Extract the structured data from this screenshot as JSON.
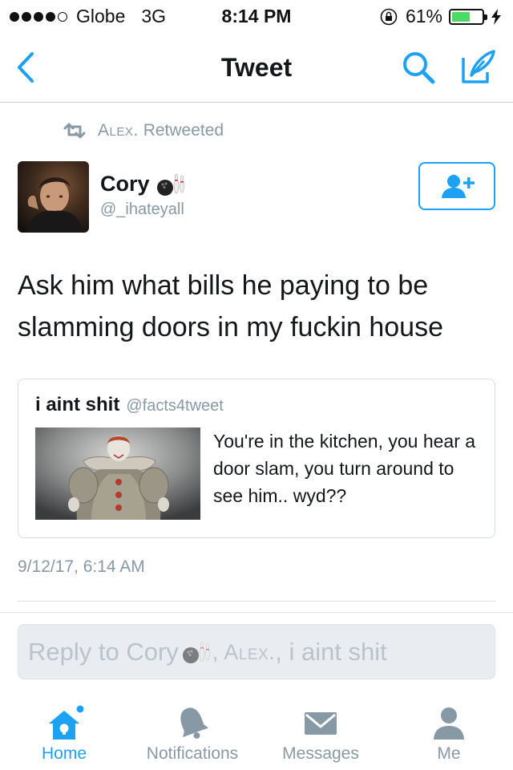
{
  "status_bar": {
    "carrier": "Globe",
    "network": "3G",
    "time": "8:14 PM",
    "battery": "61%",
    "battery_level": 0.61,
    "signal_dots_filled": 4
  },
  "nav": {
    "title": "Tweet",
    "back_icon": "chevron-left-icon",
    "search_icon": "search-icon",
    "compose_icon": "compose-icon"
  },
  "retweet_context": {
    "name": "Alex.",
    "action": "Retweeted"
  },
  "author": {
    "name": "Cory",
    "emoji": "bowling-icon",
    "handle": "@_ihateyall"
  },
  "tweet": {
    "text": "Ask him what bills he paying to be slamming doors in my fuckin house",
    "timestamp": "9/12/17, 6:14 AM"
  },
  "quoted_tweet": {
    "name": "i aint shit",
    "handle": "@facts4tweet",
    "text": "You're in the kitchen, you hear a door slam, you turn around to see him.. wyd??"
  },
  "reply": {
    "prefix": "Reply to Cory",
    "mention1": ", Alex.",
    "mention2": ", i aint shit"
  },
  "tabs": [
    {
      "label": "Home",
      "icon": "home-icon",
      "active": true
    },
    {
      "label": "Notifications",
      "icon": "bell-icon",
      "active": false
    },
    {
      "label": "Messages",
      "icon": "envelope-icon",
      "active": false
    },
    {
      "label": "Me",
      "icon": "person-icon",
      "active": false
    }
  ],
  "colors": {
    "accent": "#1da1f2",
    "secondary_text": "#8899a6",
    "battery_green": "#4cd964"
  }
}
